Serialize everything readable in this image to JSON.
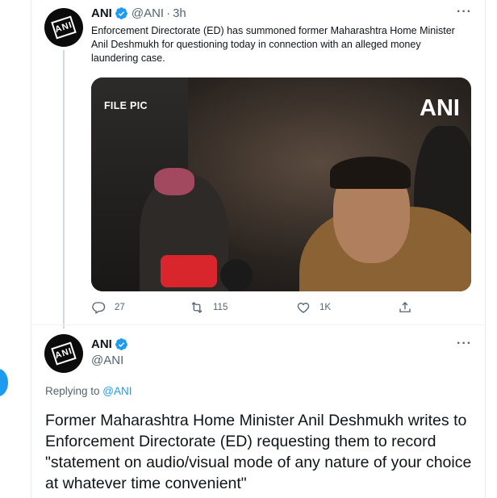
{
  "tweet1": {
    "author_name": "ANI",
    "handle": "@ANI",
    "separator": "·",
    "time": "3h",
    "avatar_text": "ANI",
    "text": "Enforcement Directorate (ED) has summoned former Maharashtra Home Minister Anil Deshmukh for questioning today in connection with an alleged money laundering case.",
    "media": {
      "overlay_label": "FILE PIC",
      "watermark": "ANI"
    },
    "actions": {
      "reply_count": "27",
      "retweet_count": "115",
      "like_count": "1K"
    },
    "more_label": "···"
  },
  "tweet2": {
    "author_name": "ANI",
    "handle": "@ANI",
    "avatar_text": "ANI",
    "more_label": "···",
    "replying_prefix": "Replying to ",
    "replying_handle": "@ANI",
    "text": "Former Maharashtra Home Minister Anil Deshmukh writes to Enforcement Directorate (ED) requesting them to record \"statement on audio/visual mode of any nature of your choice at whatever time convenient\""
  },
  "icons": {
    "verified": "verified-badge-icon",
    "reply": "reply-icon",
    "retweet": "retweet-icon",
    "like": "like-icon",
    "share": "share-icon"
  },
  "colors": {
    "accent": "#1d9bf0",
    "text_primary": "#0f1419",
    "text_secondary": "#536471"
  }
}
